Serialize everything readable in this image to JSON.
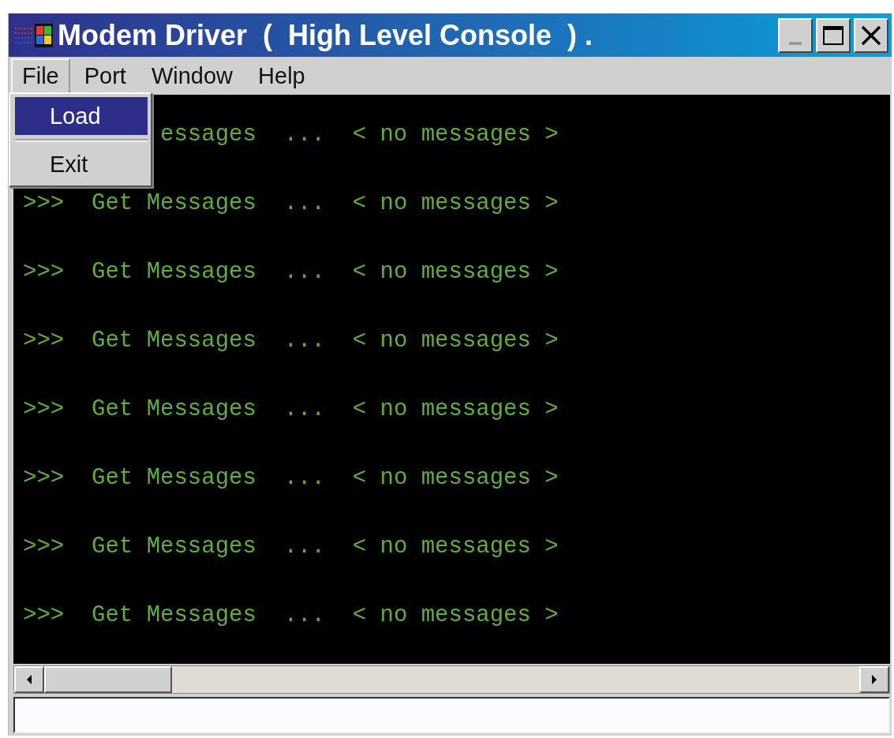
{
  "window": {
    "title": "Modem Driver  (  High Level Console  ) ."
  },
  "menu_bar": [
    {
      "label": "File",
      "selected": true
    },
    {
      "label": "Port",
      "selected": false
    },
    {
      "label": "Window",
      "selected": false
    },
    {
      "label": "Help",
      "selected": false
    }
  ],
  "open_menu": {
    "items": [
      {
        "kind": "item",
        "label": "Load",
        "selected": true
      },
      {
        "kind": "separator"
      },
      {
        "kind": "item",
        "label": "Exit",
        "selected": false
      }
    ]
  },
  "console": {
    "lines": [
      {
        "kind": "clipped",
        "text": "essages  ...  < no messages >"
      },
      {
        "kind": "full",
        "text": ">>>  Get Messages  ...  < no messages >"
      },
      {
        "kind": "full",
        "text": ">>>  Get Messages  ...  < no messages >"
      },
      {
        "kind": "full",
        "text": ">>>  Get Messages  ...  < no messages >"
      },
      {
        "kind": "full",
        "text": ">>>  Get Messages  ...  < no messages >"
      },
      {
        "kind": "full",
        "text": ">>>  Get Messages  ...  < no messages >"
      },
      {
        "kind": "full",
        "text": ">>>  Get Messages  ...  < no messages >"
      },
      {
        "kind": "full",
        "text": ">>>  Get Messages  ...  < no messages >"
      }
    ]
  }
}
